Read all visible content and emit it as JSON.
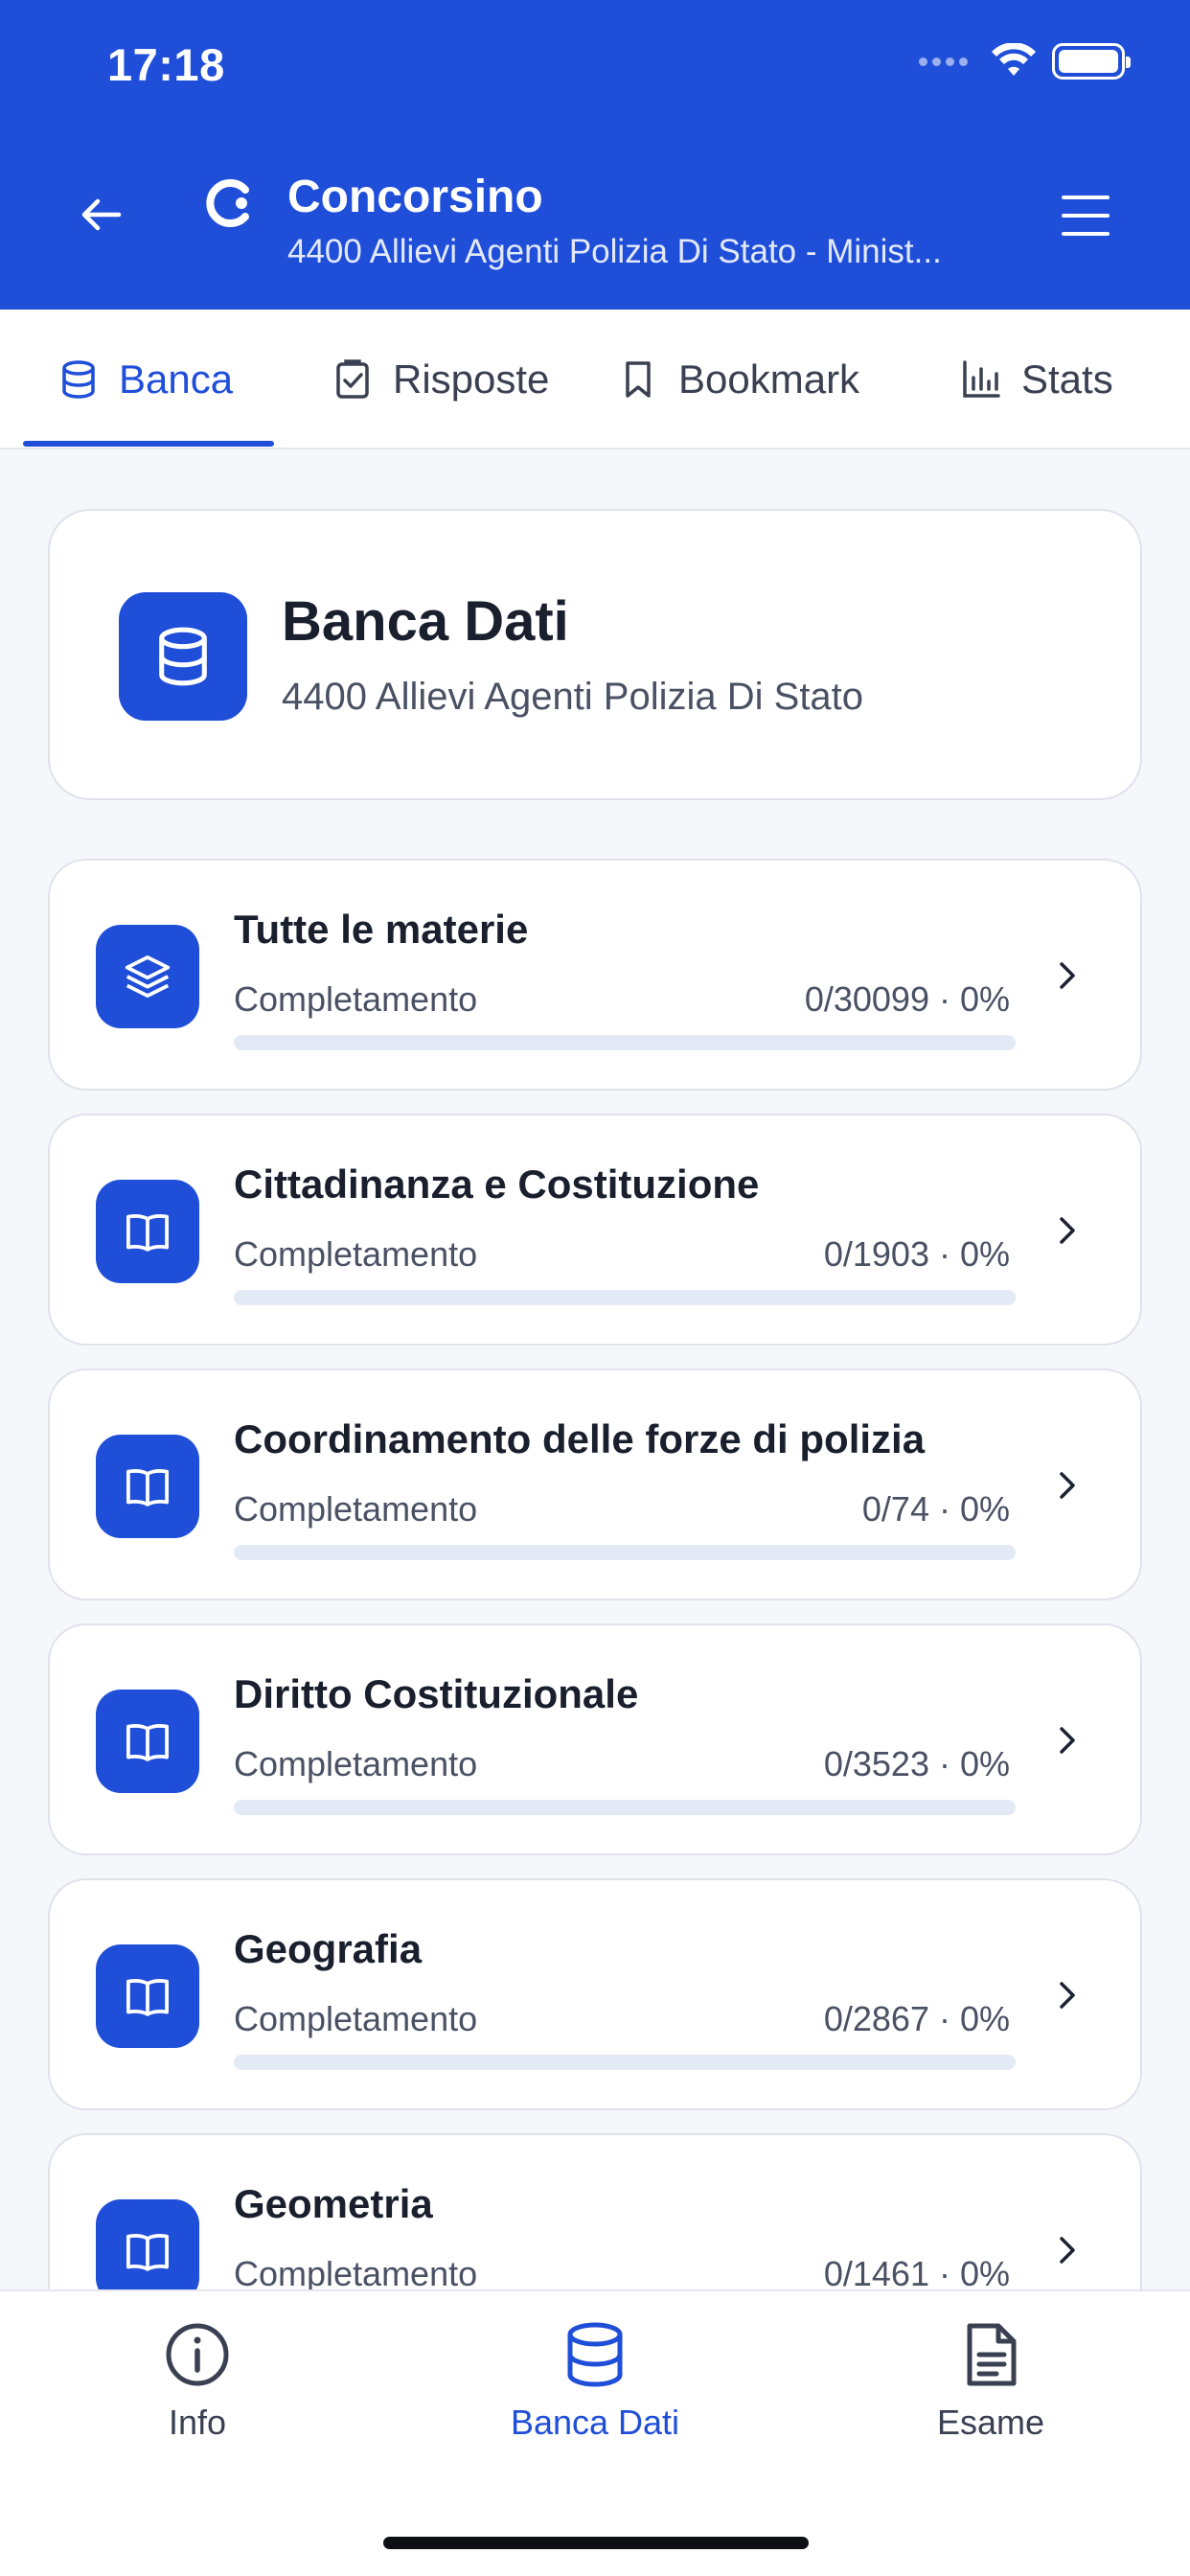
{
  "status_bar": {
    "time": "17:18"
  },
  "header": {
    "title": "Concorsino",
    "subtitle": "4400 Allievi Agenti Polizia Di Stato - Minist...",
    "accent_color": "#1f4ed8"
  },
  "tabs": [
    {
      "label": "Banca",
      "icon": "database-icon",
      "active": true
    },
    {
      "label": "Risposte",
      "icon": "clipboard-check-icon",
      "active": false
    },
    {
      "label": "Bookmark",
      "icon": "bookmark-icon",
      "active": false
    },
    {
      "label": "Stats",
      "icon": "bar-chart-icon",
      "active": false
    }
  ],
  "hero": {
    "title": "Banca Dati",
    "subtitle": "4400 Allievi Agenti Polizia Di Stato",
    "icon": "database-icon"
  },
  "subjects": [
    {
      "title": "Tutte le materie",
      "label": "Completamento",
      "stat": "0/30099 · 0%",
      "progress": 0,
      "icon": "layers-icon"
    },
    {
      "title": "Cittadinanza e Costituzione",
      "label": "Completamento",
      "stat": "0/1903 · 0%",
      "progress": 0,
      "icon": "book-icon"
    },
    {
      "title": "Coordinamento delle forze di polizia",
      "label": "Completamento",
      "stat": "0/74 · 0%",
      "progress": 0,
      "icon": "book-icon"
    },
    {
      "title": "Diritto Costituzionale",
      "label": "Completamento",
      "stat": "0/3523 · 0%",
      "progress": 0,
      "icon": "book-icon"
    },
    {
      "title": "Geografia",
      "label": "Completamento",
      "stat": "0/2867 · 0%",
      "progress": 0,
      "icon": "book-icon"
    },
    {
      "title": "Geometria",
      "label": "Completamento",
      "stat": "0/1461 · 0%",
      "progress": 0,
      "icon": "book-icon"
    }
  ],
  "bottom_nav": [
    {
      "label": "Info",
      "icon": "info-icon",
      "active": false
    },
    {
      "label": "Banca Dati",
      "icon": "database-icon",
      "active": true
    },
    {
      "label": "Esame",
      "icon": "document-icon",
      "active": false
    }
  ]
}
